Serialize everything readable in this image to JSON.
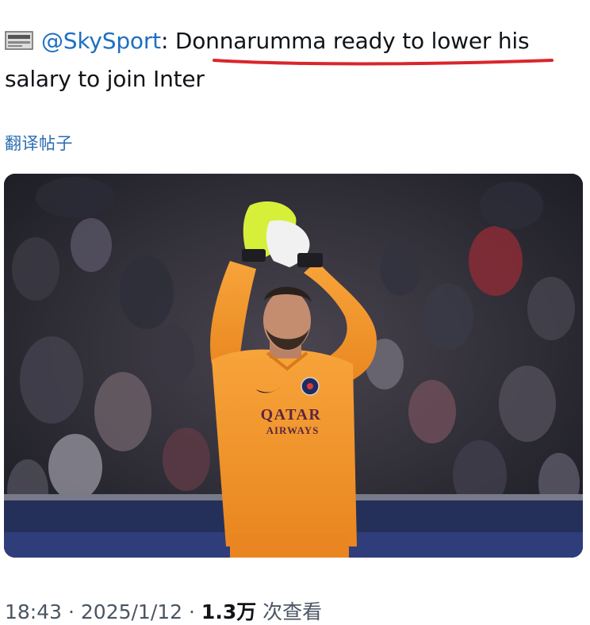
{
  "tweet": {
    "handle": "@SkySport",
    "colon": ": ",
    "text_line1": "Donnarumma ready to lower his",
    "text_line2": "salary to join Inter",
    "translate_label": "翻译帖子"
  },
  "photo": {
    "jersey_sponsor_line1": "QATAR",
    "jersey_sponsor_line2": "AIRWAYS"
  },
  "meta": {
    "time": "18:43",
    "sep1": " · ",
    "date": "2025/1/12",
    "sep2": " · ",
    "views_count": "1.3万",
    "views_label": " 次查看"
  },
  "colors": {
    "mention": "#1d6fc2",
    "underline": "#d9262b",
    "jersey": "#f2982c",
    "crowd": "#2a2c38"
  },
  "icons": {
    "flag": "flag-icon"
  }
}
